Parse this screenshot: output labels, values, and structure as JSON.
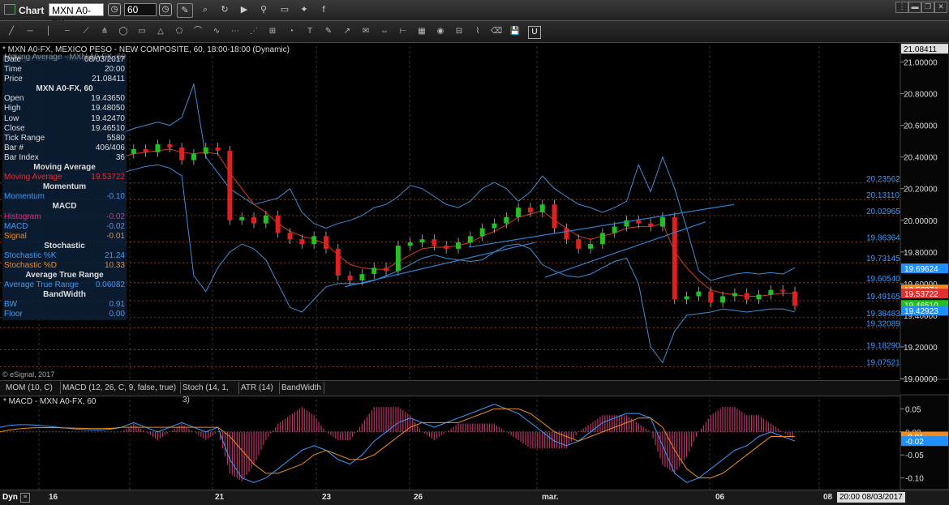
{
  "app": {
    "title": "Chart",
    "symbol": "MXN A0-FX",
    "interval": "60",
    "window_buttons": [
      "⋮",
      "▬",
      "❐",
      "✕"
    ]
  },
  "toolbar": {
    "top_icons": [
      "search-icon",
      "refresh-icon",
      "camera-icon",
      "play-icon",
      "link-icon",
      "chat-icon",
      "twitter-icon",
      "facebook-icon"
    ],
    "drawing_icons": [
      "line-icon",
      "ray-icon",
      "vline-icon",
      "hline-icon",
      "channel-icon",
      "pitchfork-icon",
      "ellipse-icon",
      "rectangle-icon",
      "triangle-icon",
      "polygon-icon",
      "arc-icon",
      "brush-icon",
      "fib-icon",
      "fib-fan-icon",
      "gann-icon",
      "cycle-icon",
      "text-icon",
      "callout-icon",
      "arrow-icon",
      "note-icon",
      "measure-icon",
      "ruler-icon",
      "table-icon",
      "eye-icon",
      "grid-icon",
      "wave-icon",
      "eraser-icon",
      "save-icon",
      "lock-icon"
    ]
  },
  "chart_header": {
    "line1": "* MXN A0-FX, MEXICO PESO - NEW COMPOSITE, 60, 18:00-18:00 (Dynamic)",
    "line2": "Bollinger Bands - MXN A0-FX, 60",
    "line3": "Moving Average - MXN A0-FX, 60",
    "copyright": "© eSignal, 2017"
  },
  "info_panel": {
    "date_label": "Date",
    "date_value": "08/03/2017",
    "time_label": "Time",
    "time_value": "20:00",
    "price_label": "Price",
    "price_value": "21.08411",
    "section_symbol": "MXN A0-FX, 60",
    "rows": [
      {
        "label": "Open",
        "value": "19.43650",
        "color": "#dddddd"
      },
      {
        "label": "High",
        "value": "19.48050",
        "color": "#dddddd"
      },
      {
        "label": "Low",
        "value": "19.42470",
        "color": "#dddddd"
      },
      {
        "label": "Close",
        "value": "19.46510",
        "color": "#dddddd"
      },
      {
        "label": "Tick Range",
        "value": "5580",
        "color": "#dddddd"
      },
      {
        "label": "Bar #",
        "value": "406/406",
        "color": "#dddddd"
      },
      {
        "label": "Bar Index",
        "value": "36",
        "color": "#dddddd"
      }
    ],
    "sections": [
      {
        "title": "Moving Average",
        "rows": [
          {
            "label": "Moving Average",
            "value": "19.53722",
            "color": "#e03030"
          }
        ]
      },
      {
        "title": "Momentum",
        "rows": [
          {
            "label": "Momentum",
            "value": "-0.10",
            "color": "#3b9cff"
          }
        ]
      },
      {
        "title": "MACD",
        "rows": [
          {
            "label": "Histogram",
            "value": "-0.02",
            "color": "#e0307a"
          },
          {
            "label": "MACD",
            "value": "-0.02",
            "color": "#3b9cff"
          },
          {
            "label": "Signal",
            "value": "-0.01",
            "color": "#f08c1e"
          }
        ]
      },
      {
        "title": "Stochastic",
        "rows": [
          {
            "label": "Stochastic %K",
            "value": "21.24",
            "color": "#3b9cff"
          },
          {
            "label": "Stochastic %D",
            "value": "10.33",
            "color": "#f08c1e"
          }
        ]
      },
      {
        "title": "Average True Range",
        "rows": [
          {
            "label": "Average True Range",
            "value": "0.06082",
            "color": "#3b9cff"
          }
        ]
      },
      {
        "title": "BandWidth",
        "rows": [
          {
            "label": "BW",
            "value": "0.91",
            "color": "#3b9cff"
          },
          {
            "label": "Floor",
            "value": "0.00",
            "color": "#3b9cff"
          }
        ]
      }
    ]
  },
  "study_tabs": [
    "MOM (10, C)",
    "MACD (12, 26, C, 9, false, true)",
    "Stoch (14, 1, 3)",
    "ATR (14)",
    "BandWidth"
  ],
  "macd_header": "* MACD - MXN A0-FX, 60",
  "bottom": {
    "mode": "Dyn",
    "x_ticks": [
      "16",
      "21",
      "23",
      "26",
      "mar.",
      "06",
      "08"
    ],
    "cursor_time": "20:00 08/03/2017"
  },
  "chart_data": [
    {
      "type": "candlestick",
      "title": "MXN A0-FX, MEXICO PESO - NEW COMPOSITE, 60",
      "ylim": [
        19.0,
        21.1
      ],
      "y_ticks": [
        "21.00000",
        "20.80000",
        "20.60000",
        "20.40000",
        "20.20000",
        "20.00000",
        "19.80000",
        "19.60000",
        "19.40000",
        "19.20000",
        "19.00000"
      ],
      "top_label": "21.08411",
      "fib_levels": [
        {
          "label": "20.23562",
          "value": 20.23562
        },
        {
          "label": "20.13110",
          "value": 20.1311
        },
        {
          "label": "20.02965",
          "value": 20.02965
        },
        {
          "label": "19.86364",
          "value": 19.86364
        },
        {
          "label": "19.73145",
          "value": 19.73145
        },
        {
          "label": "19.60540",
          "value": 19.6054
        },
        {
          "label": "19.49165",
          "value": 19.49165
        },
        {
          "label": "19.38483",
          "value": 19.38483
        },
        {
          "label": "19.32089",
          "value": 19.32089
        },
        {
          "label": "19.18290",
          "value": 19.1829
        },
        {
          "label": "19.07521",
          "value": 19.07521
        }
      ],
      "price_tags": [
        {
          "label": "19.69624",
          "value": 19.69624,
          "color": "#1e90ff"
        },
        {
          "label": "19.56274",
          "value": 19.56274,
          "color": "#f08c1e"
        },
        {
          "label": "19.53722",
          "value": 19.53722,
          "color": "#e03030"
        },
        {
          "label": "19.46510",
          "value": 19.4651,
          "color": "#22c022"
        },
        {
          "label": "19.42923",
          "value": 19.42923,
          "color": "#1e90ff"
        }
      ],
      "series": [
        {
          "name": "Close",
          "values": [
            20.42,
            20.45,
            20.43,
            20.48,
            20.46,
            20.38,
            20.42,
            20.46,
            20.44,
            20.0,
            20.02,
            19.98,
            20.03,
            19.92,
            19.88,
            19.85,
            19.9,
            19.82,
            19.65,
            19.62,
            19.66,
            19.7,
            19.68,
            19.84,
            19.86,
            19.88,
            19.84,
            19.82,
            19.86,
            19.9,
            19.95,
            19.98,
            20.02,
            20.08,
            20.05,
            20.1,
            19.95,
            19.88,
            19.82,
            19.85,
            19.92,
            19.96,
            20.0,
            19.98,
            19.96,
            20.02,
            19.5,
            19.52,
            19.55,
            19.48,
            19.52,
            19.54,
            19.5,
            19.53,
            19.56,
            19.55,
            19.46
          ]
        },
        {
          "name": "Moving Average",
          "values": [
            20.4,
            20.42,
            20.43,
            20.44,
            20.45,
            20.43,
            20.42,
            20.43,
            20.42,
            20.3,
            20.2,
            20.1,
            20.05,
            19.98,
            19.93,
            19.9,
            19.88,
            19.85,
            19.78,
            19.72,
            19.7,
            19.69,
            19.69,
            19.74,
            19.78,
            19.82,
            19.83,
            19.83,
            19.84,
            19.86,
            19.9,
            19.93,
            19.97,
            20.02,
            20.04,
            20.06,
            20.0,
            19.95,
            19.9,
            19.88,
            19.9,
            19.92,
            19.95,
            19.96,
            19.96,
            19.98,
            19.8,
            19.7,
            19.62,
            19.56,
            19.54,
            19.53,
            19.52,
            19.52,
            19.53,
            19.54,
            19.537
          ]
        },
        {
          "name": "Bollinger Upper",
          "values": [
            20.55,
            20.58,
            20.6,
            20.62,
            20.6,
            20.65,
            20.86,
            20.4,
            20.3,
            20.2,
            20.15,
            20.1,
            20.12,
            20.14,
            20.2,
            20.05,
            19.98,
            19.95,
            19.98,
            20.0,
            20.03,
            20.08,
            20.1,
            20.15,
            20.22,
            20.2,
            20.15,
            20.1,
            20.08,
            20.12,
            20.2,
            20.24,
            20.2,
            20.12,
            20.18,
            20.28,
            20.2,
            20.15,
            20.1,
            20.08,
            20.05,
            20.08,
            20.12,
            20.35,
            20.18,
            20.4,
            20.2,
            19.95,
            19.68,
            19.62,
            19.64,
            19.66,
            19.67,
            19.66,
            19.67,
            19.66,
            19.7
          ]
        },
        {
          "name": "Bollinger Lower",
          "values": [
            20.3,
            20.32,
            20.34,
            20.35,
            20.33,
            20.28,
            19.65,
            19.55,
            19.7,
            19.8,
            19.85,
            19.82,
            19.75,
            19.6,
            19.45,
            19.42,
            19.5,
            19.58,
            19.6,
            19.6,
            19.6,
            19.62,
            19.65,
            19.68,
            19.72,
            19.76,
            19.78,
            19.76,
            19.75,
            19.74,
            19.75,
            19.8,
            19.84,
            19.85,
            19.82,
            19.72,
            19.68,
            19.65,
            19.64,
            19.66,
            19.7,
            19.74,
            19.76,
            19.6,
            19.2,
            19.1,
            19.3,
            19.4,
            19.41,
            19.42,
            19.44,
            19.43,
            19.42,
            19.43,
            19.44,
            19.44,
            19.42
          ]
        }
      ],
      "trendlines": [
        {
          "from": [
            19.58,
            "23"
          ],
          "to": [
            20.08,
            "mar."
          ]
        },
        {
          "from": [
            19.64,
            "mar."
          ],
          "to": [
            20.1,
            "06"
          ]
        }
      ]
    },
    {
      "type": "line",
      "title": "MACD - MXN A0-FX, 60",
      "ylim": [
        -0.12,
        0.07
      ],
      "y_ticks": [
        "0.05",
        "0.00",
        "-0.05",
        "-0.10"
      ],
      "series": [
        {
          "name": "MACD",
          "values": [
            0.01,
            0.02,
            0.01,
            0.0,
            0.01,
            0.02,
            0.01,
            0.0,
            0.01,
            -0.06,
            -0.1,
            -0.11,
            -0.1,
            -0.08,
            -0.06,
            -0.04,
            -0.03,
            -0.04,
            -0.06,
            -0.07,
            -0.05,
            -0.02,
            0.0,
            0.02,
            0.03,
            0.02,
            0.01,
            0.02,
            0.03,
            0.04,
            0.05,
            0.06,
            0.05,
            0.04,
            0.02,
            0.0,
            -0.02,
            -0.03,
            -0.02,
            0.0,
            0.02,
            0.03,
            0.04,
            0.04,
            0.03,
            -0.03,
            -0.09,
            -0.11,
            -0.1,
            -0.08,
            -0.06,
            -0.04,
            -0.03,
            -0.01,
            0.0,
            -0.01,
            -0.02
          ]
        },
        {
          "name": "Signal",
          "values": [
            0.01,
            0.01,
            0.01,
            0.01,
            0.01,
            0.01,
            0.01,
            0.01,
            0.01,
            -0.01,
            -0.04,
            -0.07,
            -0.09,
            -0.09,
            -0.08,
            -0.07,
            -0.05,
            -0.04,
            -0.05,
            -0.06,
            -0.06,
            -0.05,
            -0.03,
            -0.01,
            0.01,
            0.02,
            0.02,
            0.02,
            0.02,
            0.03,
            0.04,
            0.05,
            0.05,
            0.05,
            0.04,
            0.02,
            0.0,
            -0.01,
            -0.02,
            -0.01,
            0.0,
            0.01,
            0.02,
            0.03,
            0.03,
            0.01,
            -0.04,
            -0.08,
            -0.1,
            -0.1,
            -0.09,
            -0.07,
            -0.05,
            -0.03,
            -0.01,
            -0.01,
            -0.01
          ]
        }
      ],
      "value_tags": [
        {
          "label": "-0.01",
          "value": -0.01,
          "color": "#f08c1e"
        },
        {
          "label": "-0.02",
          "value": -0.02,
          "color": "#1e90ff"
        }
      ]
    }
  ]
}
